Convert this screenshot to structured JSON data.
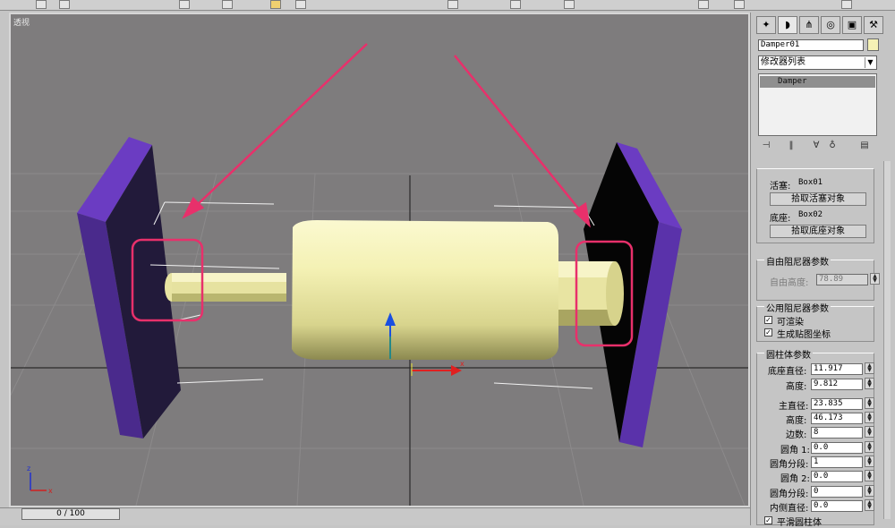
{
  "viewport": {
    "label": "透视",
    "axis_labels": {
      "x": "x",
      "z": "z"
    }
  },
  "timeline": {
    "frame": "0 / 100"
  },
  "colors": {
    "accent_highlight": "#e8306b",
    "plate_face": "#6c3cc0",
    "plate_edge": "#4e2a8f",
    "cylinder": "#f4f1b4"
  },
  "command_panel": {
    "tabs": [
      "create-icon",
      "modify-icon",
      "hierarchy-icon",
      "motion-icon",
      "display-icon",
      "utilities-icon"
    ],
    "object_name": "Damper01",
    "modifier_list": "修改器列表",
    "stack_item": "Damper",
    "pick_objects": {
      "piston_label": "活塞:",
      "piston_value": "Box01",
      "pick_piston_button": "拾取活塞对象",
      "base_label": "底座:",
      "base_value": "Box02",
      "pick_base_button": "拾取底座对象"
    },
    "free_damper": {
      "title": "自由阻尼器参数",
      "free_height_label": "自由高度:",
      "free_height_value": "78.89"
    },
    "common_damper": {
      "title": "公用阻尼器参数",
      "renderable_label": "可渲染",
      "renderable_checked": true,
      "map_coords_label": "生成贴图坐标",
      "map_coords_checked": true
    },
    "cylinder": {
      "title": "圆柱体参数",
      "base_diameter_label": "底座直径:",
      "base_diameter_value": "11.917",
      "height1_label": "高度:",
      "height1_value": "9.812",
      "main_diameter_label": "主直径:",
      "main_diameter_value": "23.835",
      "height2_label": "高度:",
      "height2_value": "46.173",
      "sides_label": "边数:",
      "sides_value": "8",
      "fillet1_label": "圆角 1:",
      "fillet1_value": "0.0",
      "fillet2_label": "圆角 2:",
      "fillet2_value": "0.0",
      "fillet_segs_label": "圆角分段:",
      "fillet_segs_value": "1",
      "fillet_segs2_label": "圆角分段:",
      "fillet_segs2_value": "0",
      "inner_diameter_label": "内侧直径:",
      "inner_diameter_value": "0.0",
      "smooth_label": "平滑圆柱体"
    }
  }
}
